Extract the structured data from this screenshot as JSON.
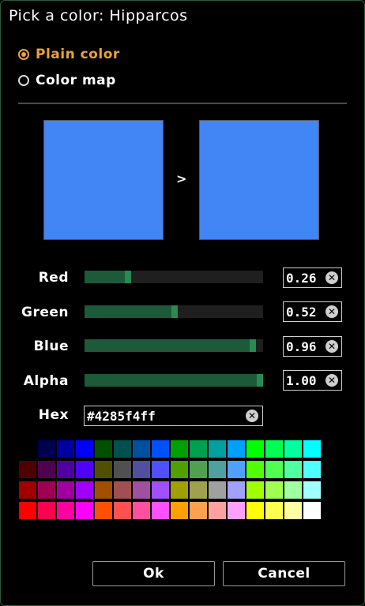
{
  "dialog": {
    "title": "Pick a color: Hipparcos"
  },
  "mode": {
    "plain_label": "Plain color",
    "map_label": "Color map",
    "selected": "plain"
  },
  "preview": {
    "old_color": "#4285f4",
    "new_color": "#4285f4",
    "arrow": ">"
  },
  "sliders": {
    "red": {
      "label": "Red",
      "value": "0.26",
      "fraction": 0.26
    },
    "green": {
      "label": "Green",
      "value": "0.52",
      "fraction": 0.52
    },
    "blue": {
      "label": "Blue",
      "value": "0.96",
      "fraction": 0.96
    },
    "alpha": {
      "label": "Alpha",
      "value": "1.00",
      "fraction": 1.0
    }
  },
  "hex": {
    "label": "Hex",
    "value": "#4285f4ff"
  },
  "palette": [
    [
      "#000000",
      "#000050",
      "#0000a0",
      "#0000ff",
      "#005000",
      "#005050",
      "#0050a0",
      "#0050ff",
      "#00a000",
      "#00a050",
      "#00a0a0",
      "#00a0ff",
      "#00ff00",
      "#00ff50",
      "#00ffa0",
      "#00ffff"
    ],
    [
      "#500000",
      "#500050",
      "#5000a0",
      "#5000ff",
      "#505000",
      "#505050",
      "#5050a0",
      "#5050ff",
      "#50a000",
      "#50a050",
      "#50a0a0",
      "#50a0ff",
      "#50ff00",
      "#50ff50",
      "#50ffa0",
      "#50ffff"
    ],
    [
      "#a00000",
      "#a00050",
      "#a000a0",
      "#a000ff",
      "#a05000",
      "#a05050",
      "#a050a0",
      "#a050ff",
      "#a0a000",
      "#a0a050",
      "#a0a0a0",
      "#a0a0ff",
      "#a0ff00",
      "#a0ff50",
      "#a0ffa0",
      "#a0ffff"
    ],
    [
      "#ff0000",
      "#ff0050",
      "#ff00a0",
      "#ff00ff",
      "#ff5000",
      "#ff5050",
      "#ff50a0",
      "#ff50ff",
      "#ffa000",
      "#ffa050",
      "#ffa0a0",
      "#ffa0ff",
      "#ffff00",
      "#ffff50",
      "#ffffa0",
      "#ffffff"
    ]
  ],
  "buttons": {
    "ok_label": "Ok",
    "cancel_label": "Cancel"
  },
  "colors": {
    "accent": "#e9a23b",
    "slider_fill": "#1d5a3a",
    "slider_handle": "#2a8a52",
    "border": "#2c5a3a"
  },
  "icons": {
    "clear": "clear-circle-x-icon",
    "radio": "radio-icon"
  }
}
